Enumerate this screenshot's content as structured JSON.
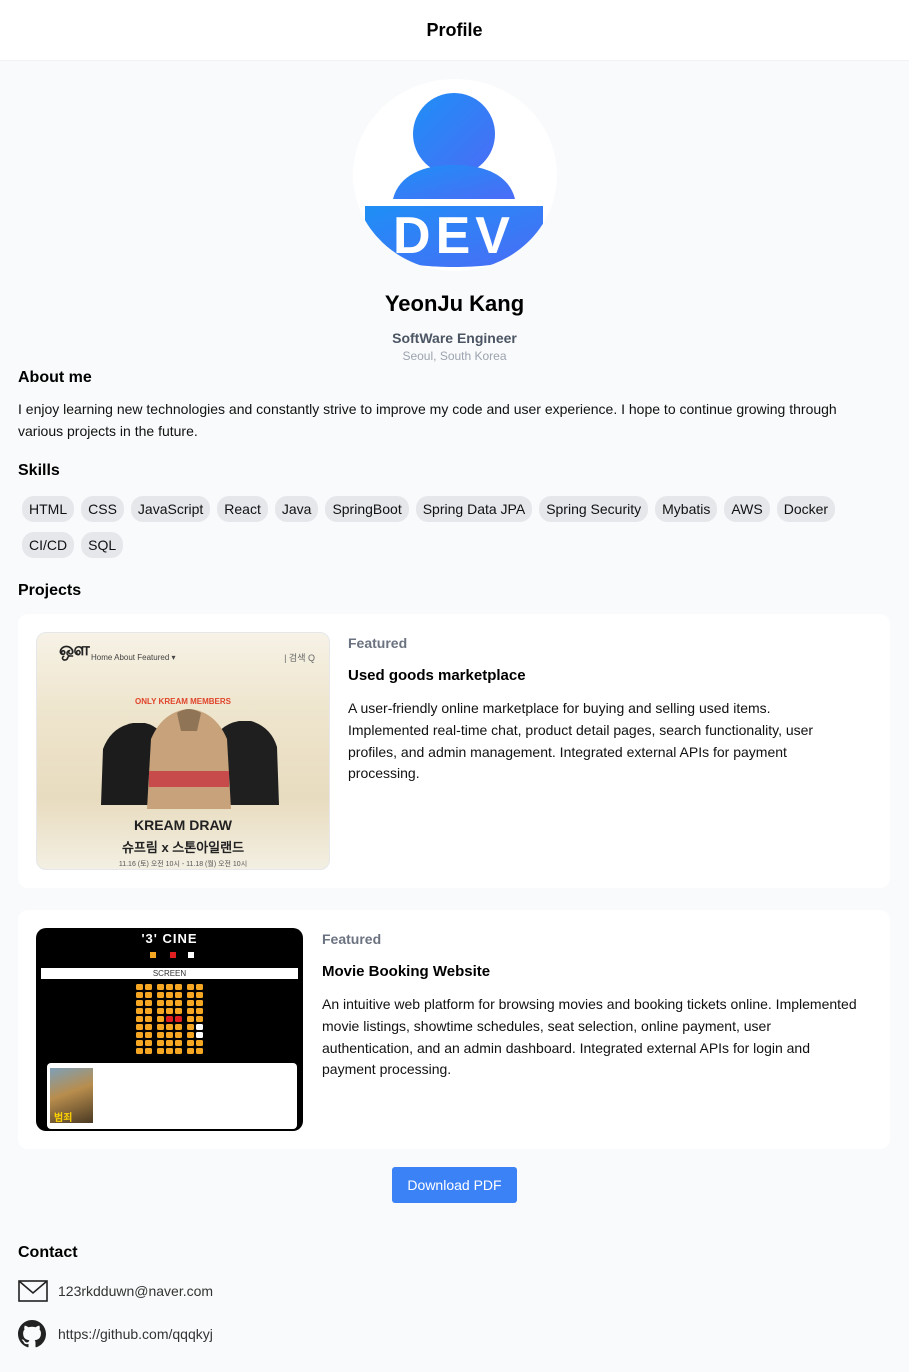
{
  "header": {
    "title": "Profile"
  },
  "profile": {
    "avatar_icon": "dev-user-icon",
    "avatar_text": "DEV",
    "name": "YeonJu Kang",
    "role": "SoftWare Engineer",
    "location": "Seoul, South Korea"
  },
  "about": {
    "title": "About me",
    "text": "I enjoy learning new technologies and constantly strive to improve my code and user experience. I hope to continue growing through various projects in the future."
  },
  "skills": {
    "title": "Skills",
    "items": [
      "HTML",
      "CSS",
      "JavaScript",
      "React",
      "Java",
      "SpringBoot",
      "Spring Data JPA",
      "Spring Security",
      "Mybatis",
      "AWS",
      "Docker",
      "CI/CD",
      "SQL"
    ]
  },
  "projects": {
    "title": "Projects",
    "items": [
      {
        "badge": "Featured",
        "title": "Used goods marketplace",
        "description": "A user-friendly online marketplace for buying and selling used items. Implemented real-time chat, product detail pages, search functionality, user profiles, and admin management. Integrated external APIs for payment processing.",
        "thumb": {
          "nav": "Home About Featured ▾",
          "search": "| 검색 Q",
          "banner": "ONLY KREAM MEMBERS",
          "headline": "KREAM DRAW",
          "subline": "슈프림 x 스톤아일랜드",
          "date": "11.16 (토) 오전 10시 - 11.18 (월) 오전 10시"
        }
      },
      {
        "badge": "Featured",
        "title": "Movie Booking Website",
        "description": "An intuitive web platform for browsing movies and booking tickets online. Implemented movie listings, showtime schedules, seat selection, online payment, user authentication, and an admin dashboard. Integrated external APIs for login and payment processing.",
        "thumb": {
          "logo": "'3' CINE",
          "screen": "SCREEN",
          "poster_label": "범죄"
        }
      }
    ]
  },
  "actions": {
    "download_label": "Download PDF"
  },
  "contact": {
    "title": "Contact",
    "email": "123rkdduwn@naver.com",
    "github": "https://github.com/qqqkyj",
    "email_icon": "mail-icon",
    "github_icon": "github-icon"
  },
  "colors": {
    "accent": "#3b82f6",
    "chip_bg": "#e5e7eb",
    "page_bg": "#f9fafb"
  }
}
